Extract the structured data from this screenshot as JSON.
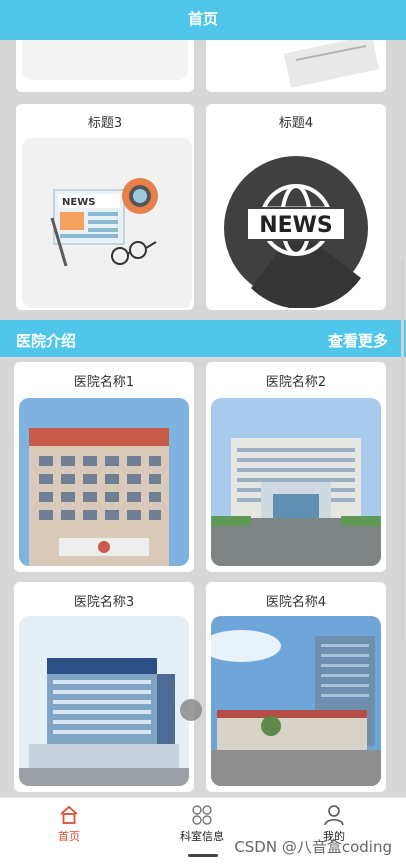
{
  "header": {
    "title": "首页"
  },
  "top_cards": [
    {
      "title": "标题3",
      "icon": "news-illustration"
    },
    {
      "title": "标题4",
      "icon": "news-globe-badge"
    }
  ],
  "section": {
    "title": "医院介绍",
    "more": "查看更多"
  },
  "hospitals": [
    {
      "name": "医院名称1"
    },
    {
      "name": "医院名称2"
    },
    {
      "name": "医院名称3"
    },
    {
      "name": "医院名称4"
    }
  ],
  "tabbar": {
    "items": [
      {
        "label": "首页",
        "icon": "home-icon",
        "active": true
      },
      {
        "label": "科室信息",
        "icon": "grid-icon",
        "active": false
      },
      {
        "label": "我的",
        "icon": "user-icon",
        "active": false
      }
    ]
  },
  "watermark": "CSDN @八音盒coding",
  "colors": {
    "accent": "#4fc6ea",
    "active_tab": "#e24b35"
  }
}
